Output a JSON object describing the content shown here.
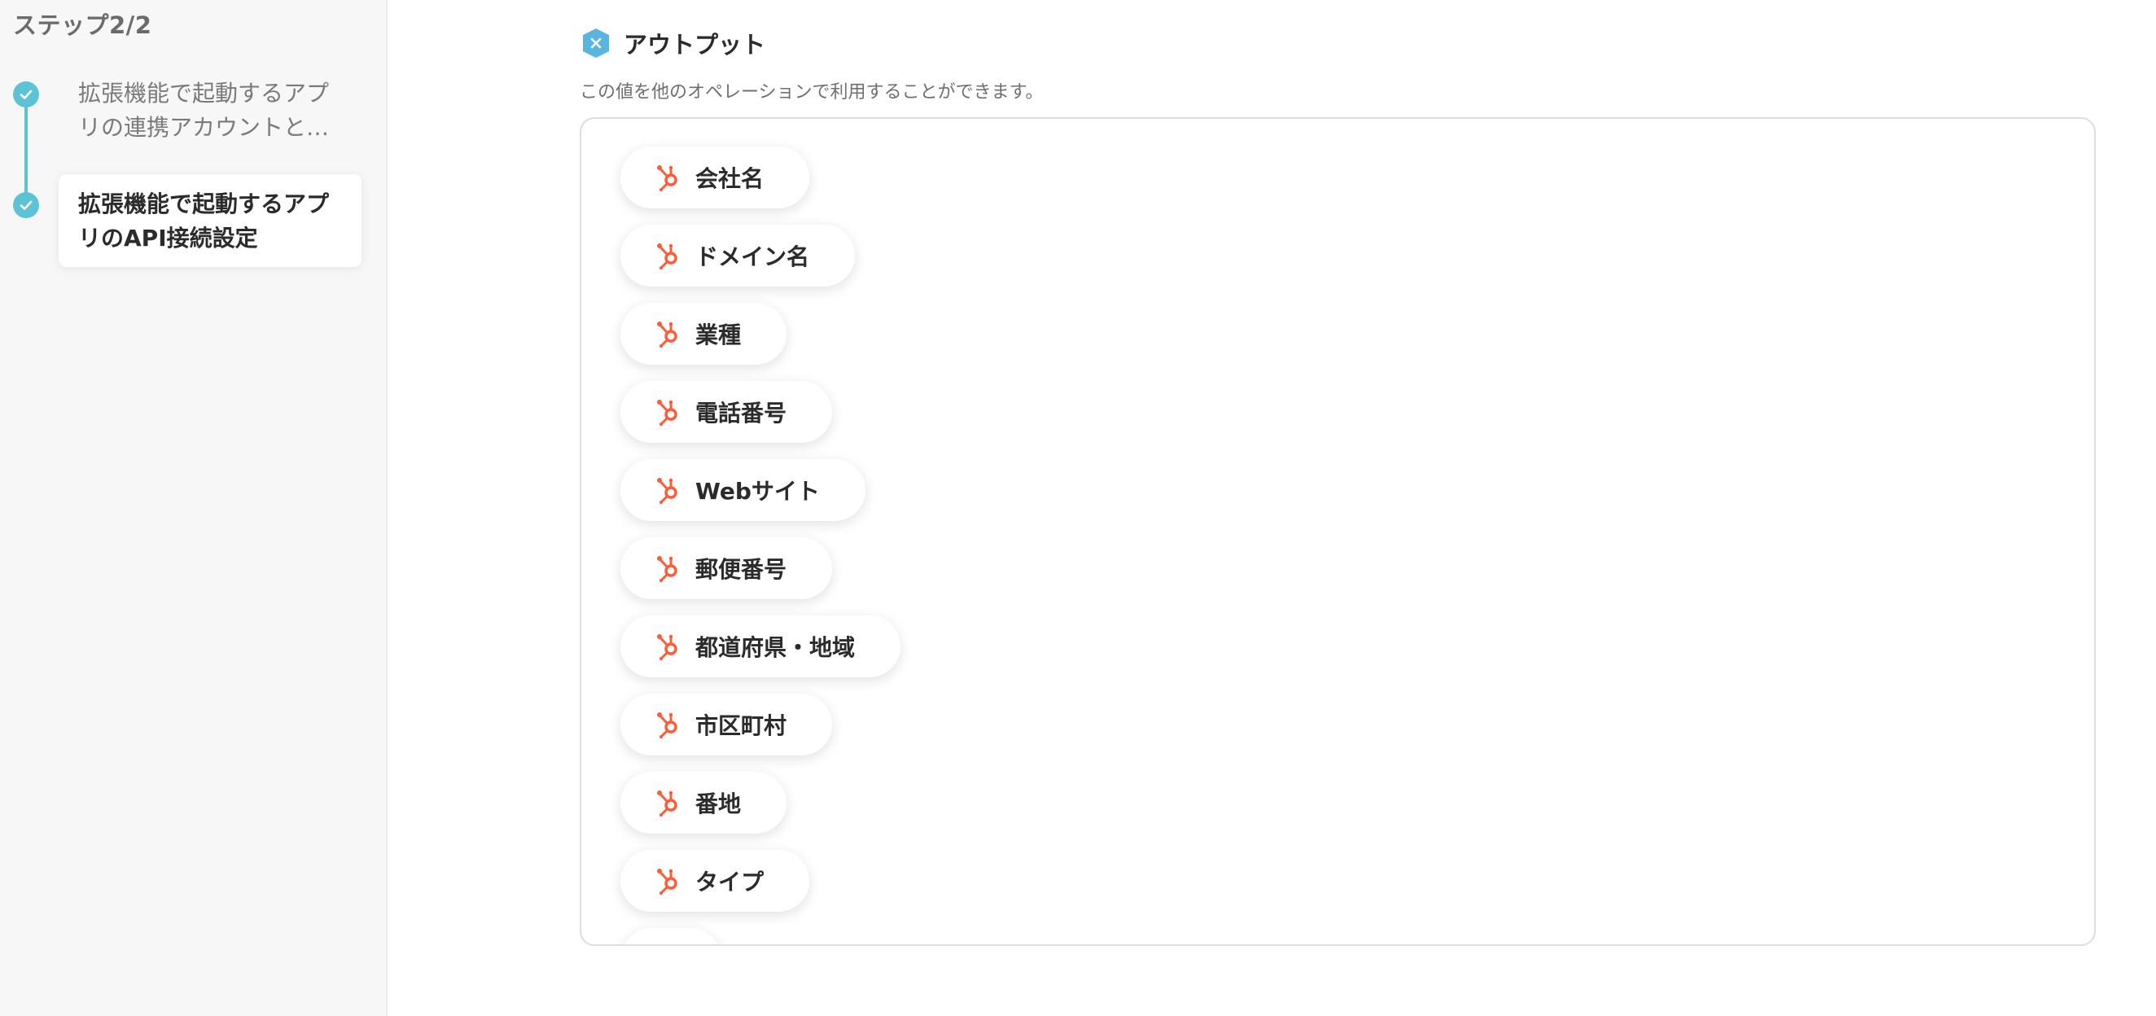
{
  "sidebar": {
    "step_counter": "ステップ2/2",
    "steps": [
      {
        "label": "拡張機能で起動するアプリの連携アカウントと…",
        "status": "completed"
      },
      {
        "label": "拡張機能で起動するアプリのAPI接続設定",
        "status": "completed",
        "active": true
      }
    ]
  },
  "main": {
    "section_title": "アウトプット",
    "section_description": "この値を他のオペレーションで利用することができます。",
    "section_icon": "hexagon-x-icon",
    "outputs": [
      {
        "label": "会社名"
      },
      {
        "label": "ドメイン名"
      },
      {
        "label": "業種"
      },
      {
        "label": "電話番号"
      },
      {
        "label": "Webサイト"
      },
      {
        "label": "郵便番号"
      },
      {
        "label": "都道府県・地域"
      },
      {
        "label": "市区町村"
      },
      {
        "label": "番地"
      },
      {
        "label": "タイプ"
      }
    ],
    "output_icon": "hubspot-icon"
  },
  "colors": {
    "accent": "#5cc3d6",
    "hubspot": "#ff5c35",
    "section_icon": "#5ab4e0"
  }
}
